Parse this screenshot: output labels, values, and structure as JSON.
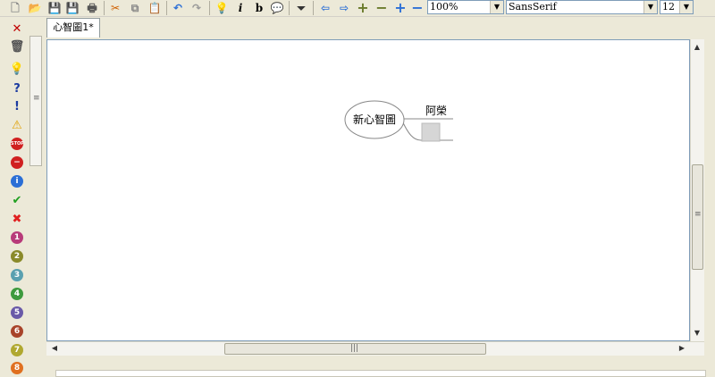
{
  "toolbar": {
    "zoom": {
      "value": "100%"
    },
    "font": {
      "value": "SansSerif"
    },
    "size": {
      "value": "12"
    }
  },
  "tabs": [
    {
      "label": "心智圖1*"
    }
  ],
  "map": {
    "root": {
      "label": "新心智圖"
    },
    "child": {
      "label": "阿榮"
    }
  },
  "priority_icons": [
    "1",
    "2",
    "3",
    "4",
    "5",
    "6",
    "7",
    "8"
  ],
  "colors": {
    "accent": "#2b6fd6",
    "priority_1": "#b83b7a",
    "priority_2": "#8a8a2a",
    "priority_3": "#5aa0b0",
    "priority_4": "#3e9a3e",
    "priority_5": "#6a5aa8",
    "priority_6": "#a8442a",
    "priority_7": "#b0a830",
    "priority_8": "#e07020"
  }
}
